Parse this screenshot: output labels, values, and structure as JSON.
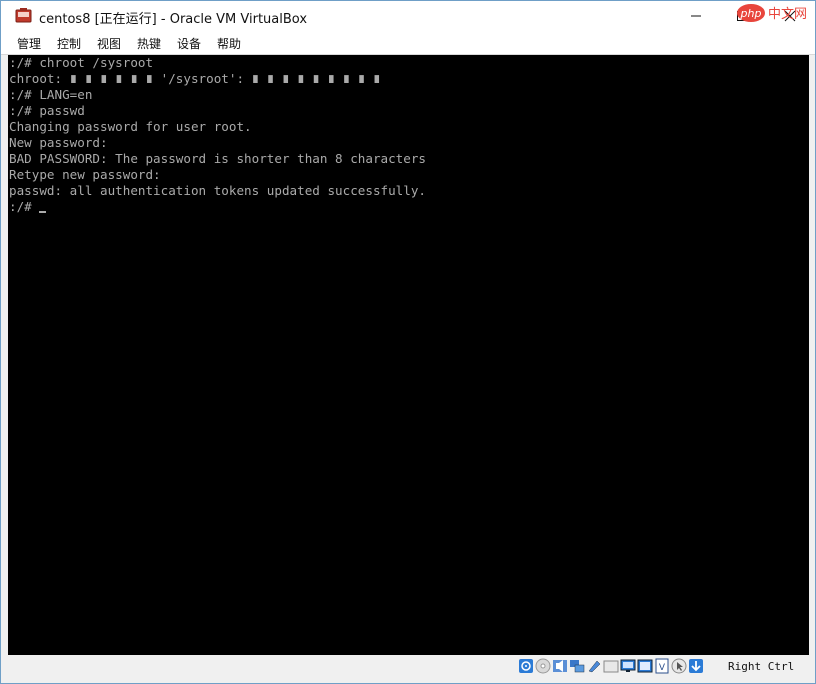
{
  "window": {
    "title": "centos8 [正在运行] - Oracle VM VirtualBox",
    "app_icon": "virtualbox-icon",
    "controls": [
      "minimize-icon",
      "maximize-icon",
      "close-icon"
    ]
  },
  "watermark": {
    "logo": "php中文网"
  },
  "menubar": {
    "items": [
      {
        "label": "管理"
      },
      {
        "label": "控制"
      },
      {
        "label": "视图"
      },
      {
        "label": "热键"
      },
      {
        "label": "设备"
      },
      {
        "label": "帮助"
      }
    ]
  },
  "console": {
    "lines": [
      ":/# chroot /sysroot",
      "chroot: ∎ ∎ ∎ ∎ ∎ ∎ '/sysroot': ∎ ∎ ∎ ∎ ∎ ∎ ∎ ∎ ∎",
      ":/# LANG=en",
      ":/# passwd",
      "Changing password for user root.",
      "New password:",
      "BAD PASSWORD: The password is shorter than 8 characters",
      "Retype new password:",
      "passwd: all authentication tokens updated successfully.",
      ":/# "
    ],
    "colors": {
      "background": "#000000",
      "text": "#aaaaaa"
    }
  },
  "statusbar": {
    "icons": [
      "hard-disk-icon",
      "optical-drive-icon",
      "audio-icon",
      "network-icon",
      "usb-icon",
      "shared-folders-icon",
      "display-icon",
      "video-capture-icon",
      "virtualization-icon",
      "mouse-integration-icon",
      "keyboard-capture-icon"
    ],
    "host_key": "Right Ctrl"
  }
}
